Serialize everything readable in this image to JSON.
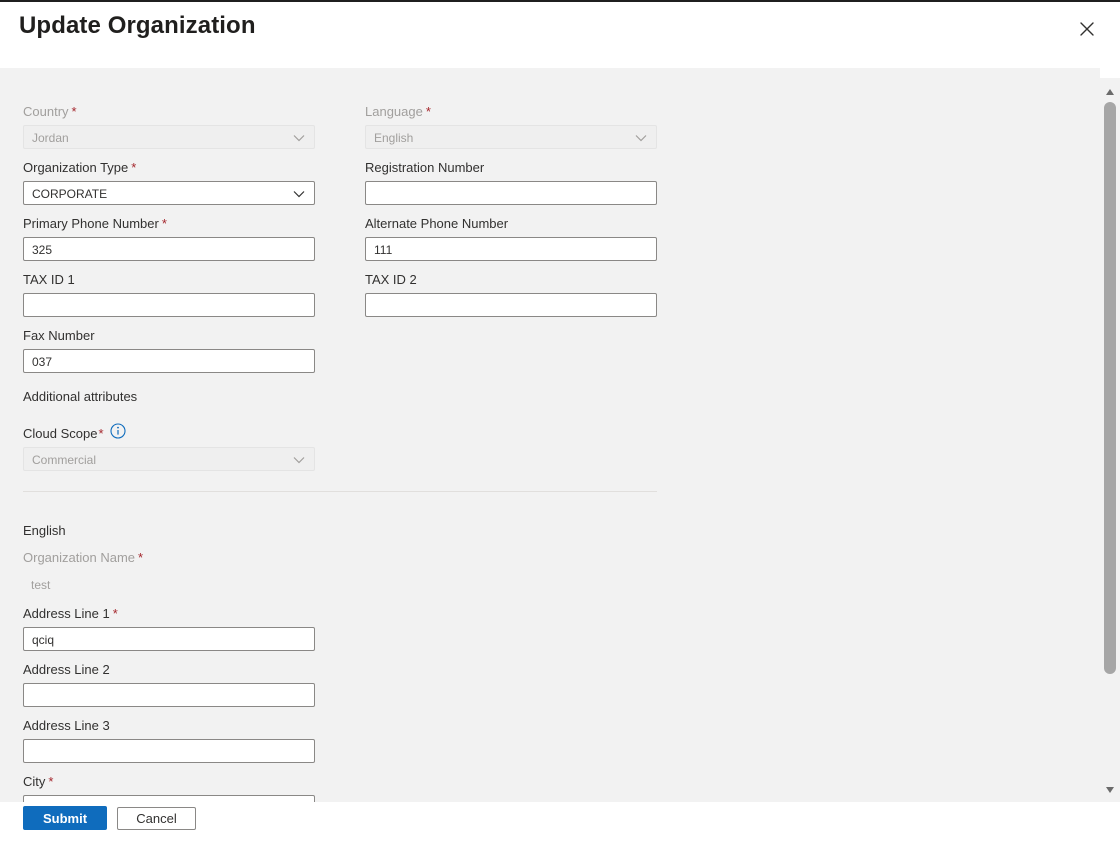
{
  "dialog": {
    "title": "Update Organization"
  },
  "fields": {
    "country": {
      "label": "Country",
      "value": "Jordan"
    },
    "language": {
      "label": "Language",
      "value": "English"
    },
    "org_type": {
      "label": "Organization Type",
      "value": "CORPORATE"
    },
    "registration_number": {
      "label": "Registration Number",
      "value": ""
    },
    "primary_phone": {
      "label": "Primary Phone Number",
      "value": "325"
    },
    "alternate_phone": {
      "label": "Alternate Phone Number",
      "value": "111"
    },
    "tax_id_1": {
      "label": "TAX ID 1",
      "value": ""
    },
    "tax_id_2": {
      "label": "TAX ID 2",
      "value": ""
    },
    "fax_number": {
      "label": "Fax Number",
      "value": "037"
    },
    "cloud_scope": {
      "label": "Cloud Scope",
      "value": "Commercial"
    },
    "org_name": {
      "label": "Organization Name",
      "value": "test"
    },
    "address_line_1": {
      "label": "Address Line 1",
      "value": "qciq"
    },
    "address_line_2": {
      "label": "Address Line 2",
      "value": ""
    },
    "address_line_3": {
      "label": "Address Line 3",
      "value": ""
    },
    "city": {
      "label": "City",
      "value": ""
    }
  },
  "sections": {
    "additional_attributes": "Additional attributes",
    "language_heading": "English"
  },
  "required_marker": "*",
  "footer": {
    "submit_label": "Submit",
    "cancel_label": "Cancel"
  },
  "colors": {
    "primary": "#0f6cbd",
    "required": "#a4262c",
    "info_icon": "#0f6cbd",
    "content_bg": "#f2f2f2"
  },
  "icons": {
    "close": "close-icon",
    "dropdown": "chevron-down-icon",
    "info": "info-icon",
    "scroll_up": "caret-up-icon",
    "scroll_down": "caret-down-icon"
  }
}
